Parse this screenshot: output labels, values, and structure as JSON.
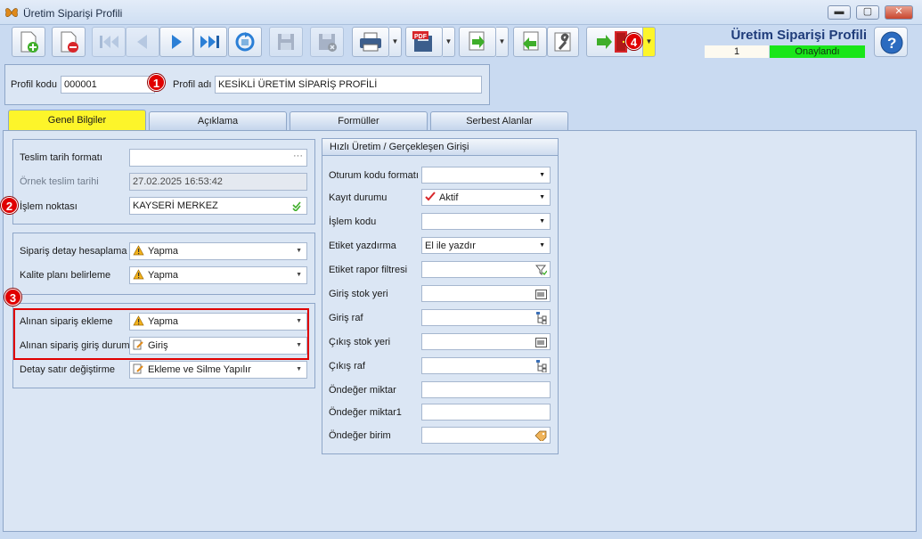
{
  "window": {
    "title": "Üretim Siparişi Profili",
    "app_icon": "butterfly-icon",
    "controls": {
      "minimize": "▬",
      "maximize": "▢",
      "close": "✕"
    }
  },
  "toolbar": {
    "buttons": [
      {
        "name": "new-document-button",
        "icon": "new-document-icon"
      },
      {
        "name": "delete-document-button",
        "icon": "delete-document-icon"
      },
      {
        "name": "first-record-button",
        "icon": "first-record-icon"
      },
      {
        "name": "previous-record-button",
        "icon": "previous-record-icon"
      },
      {
        "name": "next-record-button",
        "icon": "next-record-icon"
      },
      {
        "name": "last-record-button",
        "icon": "last-record-icon"
      },
      {
        "name": "refresh-button",
        "icon": "refresh-icon"
      },
      {
        "name": "save-button",
        "icon": "save-icon"
      },
      {
        "name": "cancel-save-button",
        "icon": "cancel-save-icon"
      },
      {
        "name": "print-button",
        "icon": "printer-icon"
      },
      {
        "name": "export-pdf-button",
        "icon": "pdf-icon",
        "label": "PDF"
      },
      {
        "name": "transfer-button",
        "icon": "transfer-icon"
      },
      {
        "name": "import-button",
        "icon": "import-icon"
      },
      {
        "name": "settings-button",
        "icon": "wrench-icon"
      },
      {
        "name": "exit-button",
        "icon": "exit-door-icon"
      }
    ]
  },
  "document": {
    "title": "Üretim Siparişi Profili",
    "number": "1",
    "status": "Onaylandı",
    "status_color": "#19e619"
  },
  "header": {
    "profile_code_label": "Profil kodu",
    "profile_code_value": "000001",
    "profile_name_label": "Profil adı",
    "profile_name_value": "KESİKLİ ÜRETİM SİPARİŞ PROFİLİ"
  },
  "tabs": [
    {
      "label": "Genel Bilgiler",
      "active": true
    },
    {
      "label": "Açıklama",
      "active": false
    },
    {
      "label": "Formüller",
      "active": false
    },
    {
      "label": "Serbest Alanlar",
      "active": false
    }
  ],
  "general": {
    "delivery_date_format_label": "Teslim tarih formatı",
    "delivery_date_format_value": "",
    "sample_delivery_date_label": "Örnek teslim tarihi",
    "sample_delivery_date_value": "27.02.2025 16:53:42",
    "operation_point_label": "İşlem noktası",
    "operation_point_value": "KAYSERİ MERKEZ",
    "order_detail_calc_label": "Sipariş detay hesaplama",
    "order_detail_calc_value": "Yapma",
    "quality_plan_label": "Kalite planı belirleme",
    "quality_plan_value": "Yapma",
    "received_order_add_label": "Alınan sipariş ekleme",
    "received_order_add_value": "Yapma",
    "received_order_entry_label": "Alınan sipariş giriş durum",
    "received_order_entry_value": "Giriş",
    "detail_row_change_label": "Detay satır değiştirme",
    "detail_row_change_value": "Ekleme ve Silme Yapılır"
  },
  "quick": {
    "title": "Hızlı Üretim / Gerçekleşen Girişi",
    "fields": [
      {
        "label": "Oturum kodu formatı",
        "value": "",
        "kind": "combo"
      },
      {
        "label": "Kayıt durumu",
        "value": "Aktif",
        "kind": "combo-check"
      },
      {
        "label": "İşlem kodu",
        "value": "",
        "kind": "combo"
      },
      {
        "label": "Etiket yazdırma",
        "value": "El ile yazdır",
        "kind": "combo"
      },
      {
        "label": "Etiket rapor filtresi",
        "value": "",
        "kind": "filter"
      },
      {
        "label": "Giriş stok yeri",
        "value": "",
        "kind": "barcode"
      },
      {
        "label": "Giriş raf",
        "value": "",
        "kind": "tree"
      },
      {
        "label": "Çıkış stok yeri",
        "value": "",
        "kind": "barcode"
      },
      {
        "label": "Çıkış raf",
        "value": "",
        "kind": "tree"
      },
      {
        "label": "Öndeğer miktar",
        "value": "",
        "kind": "text"
      },
      {
        "label": "Öndeğer miktar1",
        "value": "",
        "kind": "text"
      },
      {
        "label": "Öndeğer birim",
        "value": "",
        "kind": "tag"
      }
    ]
  },
  "annotations": [
    "1",
    "2",
    "3",
    "4"
  ],
  "colors": {
    "accent": "#fdf52a",
    "highlight": "#e00000",
    "panel": "#dbe6f4"
  }
}
